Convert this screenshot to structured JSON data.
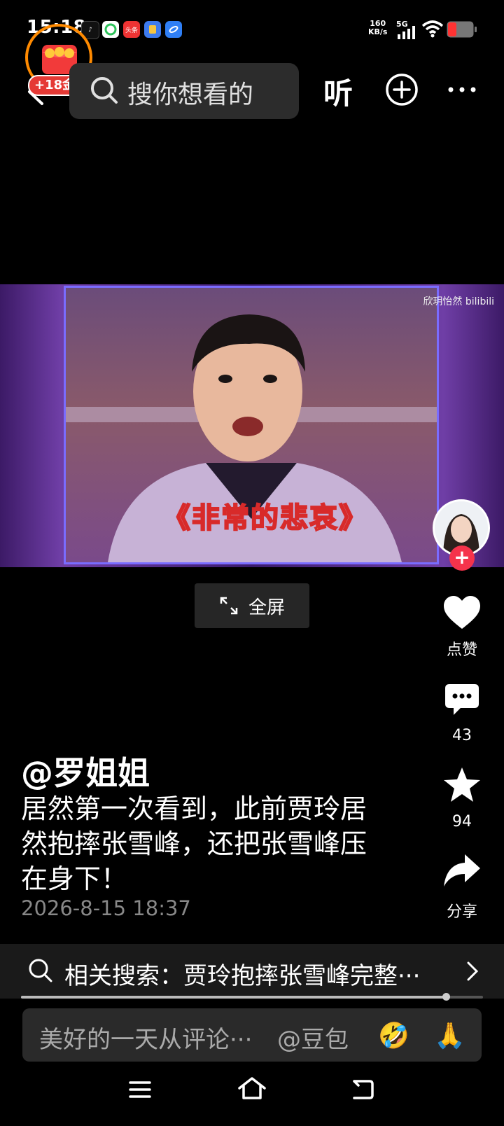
{
  "status_bar": {
    "time": "15:18",
    "net_speed_value": "160",
    "net_speed_unit": "KB/s",
    "network": "5G",
    "apps": [
      "tiktok-icon",
      "wechat-icon",
      "toutiao-icon",
      "files-icon",
      "browser-icon"
    ],
    "toutiao_label": "头条"
  },
  "coin_badge": {
    "label": "+18金币"
  },
  "header": {
    "search_placeholder": "搜你想看的",
    "listen_label": "听"
  },
  "video": {
    "watermark": "欣玥怡然 bilibili",
    "subtitle": "《非常的悲哀》",
    "fullscreen_label": "全屏"
  },
  "actions": {
    "like_label": "点赞",
    "comment_count": "43",
    "favorite_count": "94",
    "share_label": "分享"
  },
  "post": {
    "author": "@罗姐姐",
    "caption": "居然第一次看到，此前贾玲居然抱摔张雪峰，还把张雪峰压在身下！",
    "date": "2026-8-15 18:37"
  },
  "related_search": {
    "text": "相关搜索：贾玲抱摔张雪峰完整···",
    "progress": 0.92
  },
  "comment_bar": {
    "placeholder": "美好的一天从评论···",
    "mention": "@豆包",
    "emoji_1": "🤣",
    "emoji_2": "🙏"
  },
  "colors": {
    "accent_red": "#f5334b",
    "coin_orange": "#ff8a00",
    "video_border": "#7a6cff",
    "subtitle_yellow": "#ffdf2f"
  }
}
